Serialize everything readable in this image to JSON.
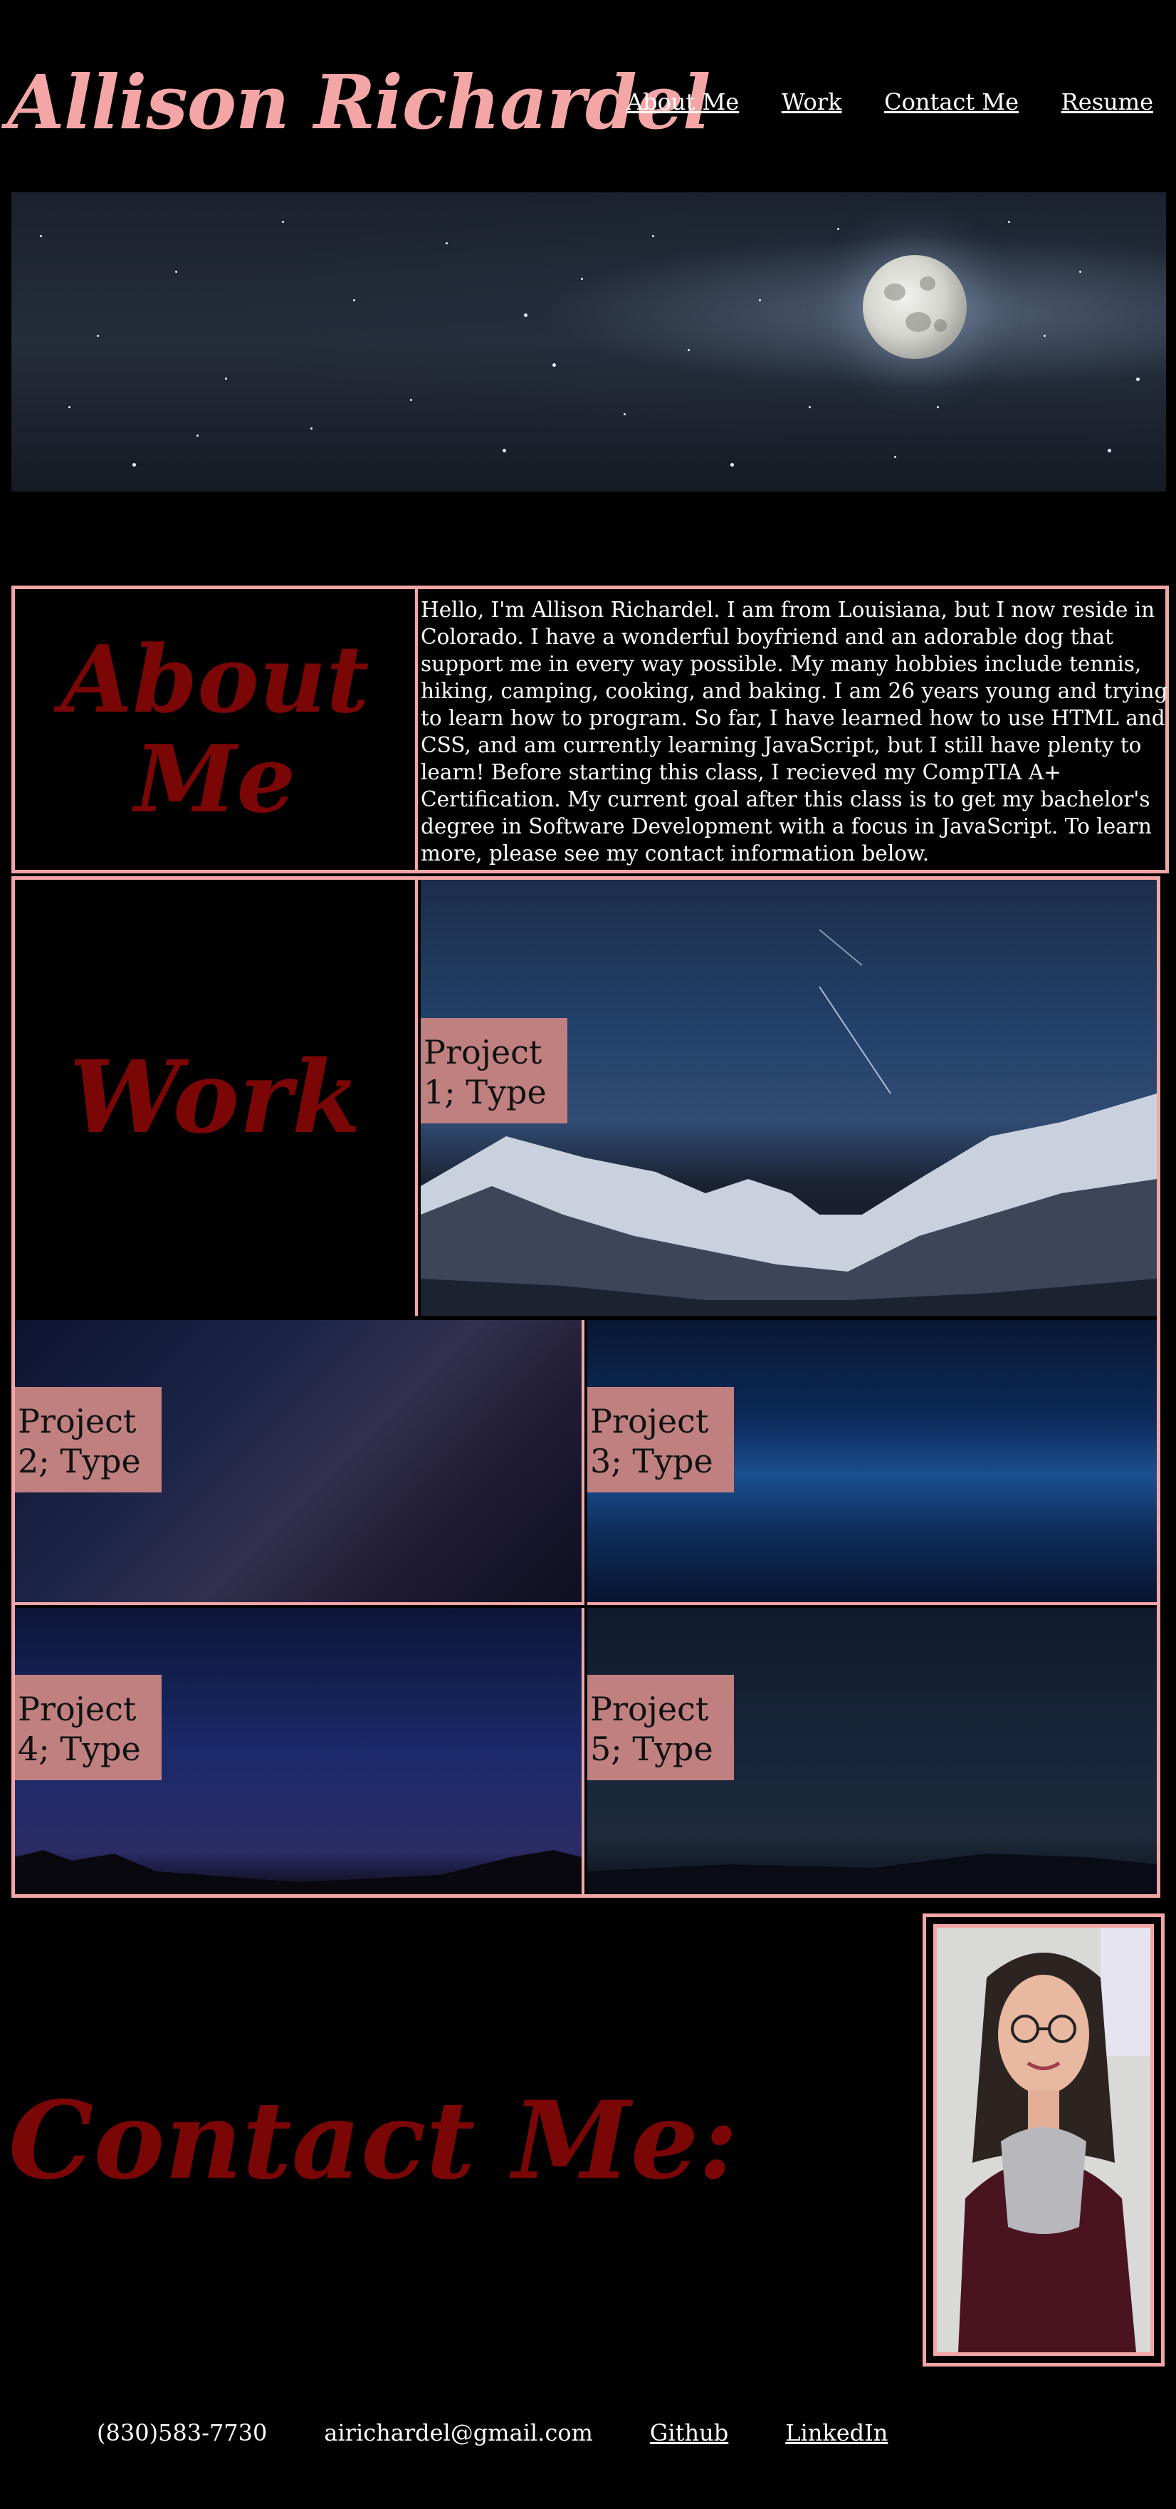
{
  "header": {
    "title": "Allison Richardel",
    "nav": [
      {
        "label": "About Me"
      },
      {
        "label": "Work"
      },
      {
        "label": "Contact Me"
      },
      {
        "label": "Resume"
      }
    ]
  },
  "about": {
    "heading": "About Me",
    "text": "Hello, I'm Allison Richardel. I am from Louisiana, but I now reside in Colorado. I have a wonderful boyfriend and an adorable dog that support me in every way possible. My many hobbies include tennis, hiking, camping, cooking, and baking. I am 26 years young and trying to learn how to program. So far, I have learned how to use HTML and CSS, and am currently learning JavaScript, but I still have plenty to learn! Before starting this class, I recieved my CompTIA A+ Certification. My current goal after this class is to get my bachelor's degree in Software Development with a focus in JavaScript. To learn more, please see my contact information below."
  },
  "work": {
    "heading": "Work",
    "projects": [
      {
        "label": "Project 1; Type"
      },
      {
        "label": "Project 2; Type"
      },
      {
        "label": "Project 3; Type"
      },
      {
        "label": "Project 4; Type"
      },
      {
        "label": "Project 5; Type"
      }
    ]
  },
  "contact": {
    "heading": "Contact Me:",
    "phone": "(830)583-7730",
    "email": "airichardel@gmail.com",
    "links": [
      {
        "label": "Github"
      },
      {
        "label": "LinkedIn"
      }
    ]
  },
  "colors": {
    "accent_pink": "#f4a6a6",
    "heading_red": "#7a0606",
    "label_bg": "#c08080",
    "background": "#000000"
  }
}
